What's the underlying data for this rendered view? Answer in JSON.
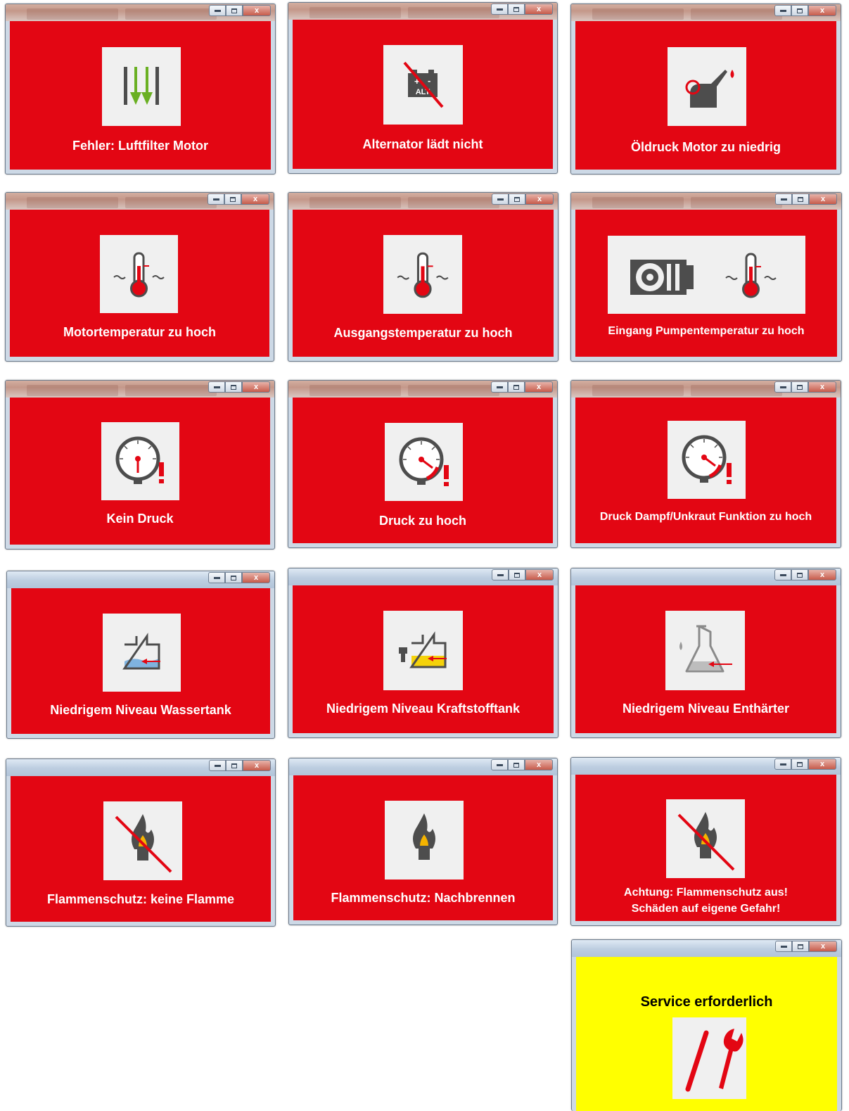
{
  "windows": [
    {
      "message": "Fehler: Luftfilter Motor",
      "icon": "air-filter-icon"
    },
    {
      "message": "Alternator lädt nicht",
      "icon": "alternator-icon",
      "icon_label": "ALT"
    },
    {
      "message": "Öldruck Motor zu niedrig",
      "icon": "oil-can-icon"
    },
    {
      "message": "Motortemperatur zu hoch",
      "icon": "thermometer-icon"
    },
    {
      "message": "Ausgangstemperatur zu hoch",
      "icon": "thermometer-icon"
    },
    {
      "message": "Eingang Pumpentemperatur zu hoch",
      "icon": "pump-thermometer-icon"
    },
    {
      "message": "Kein Druck",
      "icon": "pressure-gauge-icon"
    },
    {
      "message": "Druck zu hoch",
      "icon": "pressure-gauge-high-icon"
    },
    {
      "message": "Druck Dampf/Unkraut Funktion zu hoch",
      "icon": "pressure-gauge-high-icon"
    },
    {
      "message": "Niedrigem Niveau Wassertank",
      "icon": "water-tank-icon"
    },
    {
      "message": "Niedrigem Niveau Kraftstofftank",
      "icon": "fuel-tank-icon"
    },
    {
      "message": "Niedrigem Niveau Enthärter",
      "icon": "softener-flask-icon"
    },
    {
      "message": "Flammenschutz: keine Flamme",
      "icon": "no-flame-icon"
    },
    {
      "message": "Flammenschutz: Nachbrennen",
      "icon": "flame-icon"
    },
    {
      "message_line1": "Achtung: Flammenschutz aus!",
      "message_line2": "Schäden auf eigene Gefahr!",
      "icon": "no-flame-icon"
    },
    {
      "message": "Service erforderlich",
      "icon": "service-tools-icon"
    }
  ],
  "controls": {
    "close_label": "x"
  },
  "colors": {
    "alarm_red": "#e30613",
    "warning_yellow": "#ffff00",
    "icon_bg": "#f0f0f0",
    "icon_grey": "#4d4d4d",
    "icon_red": "#e30613",
    "filter_green": "#6ab023",
    "water_blue": "#7fb3e0",
    "fuel_yellow": "#f5d20a"
  }
}
